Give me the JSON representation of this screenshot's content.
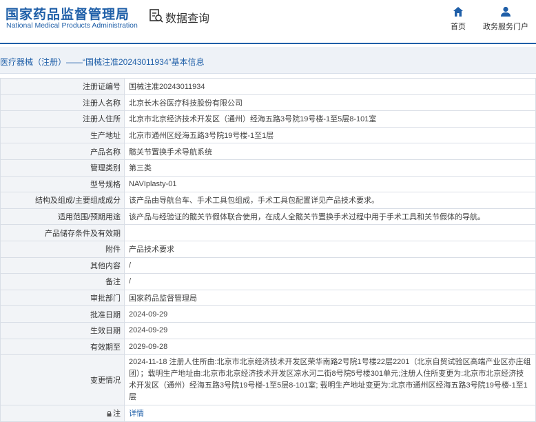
{
  "header": {
    "org_name_cn": "国家药品监督管理局",
    "org_name_en": "National Medical Products Administration",
    "query_title": "数据查询",
    "query_icon": "search-doc-icon",
    "nav": [
      {
        "label": "首页",
        "icon": "home-icon"
      },
      {
        "label": "政务服务门户",
        "icon": "user-icon"
      }
    ]
  },
  "breadcrumb": "医疗器械（注册）——“国械注准20243011934”基本信息",
  "details": [
    {
      "key": "注册证编号",
      "value": "国械注准20243011934"
    },
    {
      "key": "注册人名称",
      "value": "北京长木谷医疗科技股份有限公司"
    },
    {
      "key": "注册人住所",
      "value": "北京市北京经济技术开发区（通州）经海五路3号院19号楼-1至5层8-101室"
    },
    {
      "key": "生产地址",
      "value": "北京市通州区经海五路3号院19号楼-1至1层"
    },
    {
      "key": "产品名称",
      "value": "髋关节置换手术导航系统"
    },
    {
      "key": "管理类别",
      "value": "第三类"
    },
    {
      "key": "型号规格",
      "value": "NAVIplasty-01"
    },
    {
      "key": "结构及组成/主要组成成分",
      "value": "该产品由导航台车、手术工具包组成，手术工具包配置详见产品技术要求。"
    },
    {
      "key": "适用范围/预期用途",
      "value": "该产品与经验证的髋关节假体联合使用，在成人全髋关节置换手术过程中用于手术工具和关节假体的导航。"
    },
    {
      "key": "产品储存条件及有效期",
      "value": ""
    },
    {
      "key": "附件",
      "value": "产品技术要求"
    },
    {
      "key": "其他内容",
      "value": "/"
    },
    {
      "key": "备注",
      "value": "/"
    },
    {
      "key": "审批部门",
      "value": "国家药品监督管理局"
    },
    {
      "key": "批准日期",
      "value": "2024-09-29"
    },
    {
      "key": "生效日期",
      "value": "2024-09-29"
    },
    {
      "key": "有效期至",
      "value": "2029-09-28"
    }
  ],
  "change": {
    "key": "变更情况",
    "value": "2024-11-18 注册人住所由:北京市北京经济技术开发区荣华南路2号院1号楼22层2201（北京自贸试验区高端产业区亦庄组团）；载明生产地址由:北京市北京经济技术开发区凉水河二街8号院5号楼301单元;注册人住所变更为:北京市北京经济技术开发区（通州）经海五路3号院19号楼-1至5层8-101室; 载明生产地址变更为:北京市通州区经海五路3号院19号楼-1至1层"
  },
  "note": {
    "key": "注",
    "icon": "lock-icon",
    "link": "详情"
  },
  "colors": {
    "brand": "#1f5fa8",
    "key_bg": "#f2f4f7",
    "border": "#d9dee6"
  }
}
